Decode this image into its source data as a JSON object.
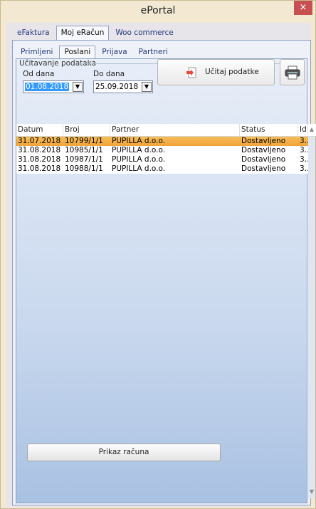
{
  "window": {
    "title": "ePortal",
    "close_label": "×"
  },
  "tabs_outer": [
    {
      "label": "eFaktura",
      "active": false
    },
    {
      "label": "Moj eRačun",
      "active": true
    },
    {
      "label": "Woo commerce",
      "active": false
    }
  ],
  "tabs_inner": [
    {
      "label": "Primljeni",
      "active": false
    },
    {
      "label": "Poslani",
      "active": true
    },
    {
      "label": "Prijava",
      "active": false
    },
    {
      "label": "Partneri",
      "active": false
    }
  ],
  "loading_group": {
    "legend": "Učitavanje podataka",
    "from_label": "Od dana",
    "from_value": "01.08.2018",
    "to_label": "Do dana",
    "to_value": "25.09.2018",
    "load_button": "Učitaj podatke",
    "load_icon": "arrow-document-icon",
    "print_icon": "printer-icon"
  },
  "grid": {
    "columns": [
      "Datum",
      "Broj",
      "Partner",
      "Status",
      "Id"
    ],
    "rows": [
      {
        "datum": "31.07.2018",
        "broj": "10799/1/1",
        "partner": "PUPILLA d.o.o.",
        "status": "Dostavljeno",
        "id": "3…",
        "selected": true
      },
      {
        "datum": "31.08.2018",
        "broj": "10985/1/1",
        "partner": "PUPILLA d.o.o.",
        "status": "Dostavljeno",
        "id": "3…",
        "selected": false
      },
      {
        "datum": "31.08.2018",
        "broj": "10987/1/1",
        "partner": "PUPILLA d.o.o.",
        "status": "Dostavljeno",
        "id": "3…",
        "selected": false
      },
      {
        "datum": "31.08.2018",
        "broj": "10988/1/1",
        "partner": "PUPILLA d.o.o.",
        "status": "Dostavljeno",
        "id": "3…",
        "selected": false
      }
    ]
  },
  "footer": {
    "show_invoice_button": "Prikaz računa"
  },
  "colors": {
    "selected_row": "#f2a33a",
    "close_button": "#c75050",
    "tab_text": "#243a7a"
  }
}
